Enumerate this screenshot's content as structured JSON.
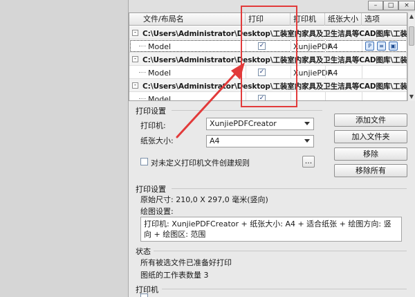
{
  "grid": {
    "columns": [
      "文件/布局名",
      "打印",
      "打印机",
      "纸张大小",
      "选项"
    ],
    "groups": [
      {
        "path": "C:\\Users\\Administrator\\Desktop\\工装室内家具及卫生洁具等CAD图库\\工装室内",
        "item": {
          "layout": "Model",
          "printer": "XunjiePDF",
          "size": "A4"
        }
      },
      {
        "path": "C:\\Users\\Administrator\\Desktop\\工装室内家具及卫生洁具等CAD图库\\工装室内",
        "item": {
          "layout": "Model",
          "printer": "XunjiePDF",
          "size": "A4"
        }
      },
      {
        "path": "C:\\Users\\Administrator\\Desktop\\工装室内家具及卫生洁具等CAD图库\\工装室内",
        "item": {
          "layout": "Model",
          "printer": "",
          "size": ""
        }
      }
    ],
    "expander": "-",
    "check_mark": "✓"
  },
  "print_settings": {
    "title": "打印设置",
    "printer_label": "打印机:",
    "printer_value": "XunjiePDFCreator",
    "paper_label": "纸张大小:",
    "paper_value": "A4",
    "rule_label": "对未定义打印机文件创建规则",
    "ellipsis": "..."
  },
  "buttons": {
    "add_file": "添加文件",
    "add_folder": "加入文件夹",
    "remove": "移除",
    "remove_all": "移除所有"
  },
  "page_settings": {
    "title": "打印设置",
    "original_size": "原始尺寸: 210,0 X 297,0 毫米(竖向)",
    "plot_settings_label": "绘图设置:",
    "plot_settings_text": "打印机: XunjiePDFCreator + 纸张大小: A4 + 适合纸张 + 绘图方向: 竖向 + 绘图区: 范围"
  },
  "status": {
    "title": "状态",
    "line1": "所有被选文件已准备好打印",
    "line2": "图纸的工作表数量 3"
  },
  "printer_section": {
    "title": "打印机"
  },
  "window": {
    "min": "–",
    "max": "□",
    "close": "×"
  },
  "colors": {
    "highlight_box": "#e23a3a"
  },
  "icons": [
    "pdf-print-icon",
    "layers-icon",
    "page-setup-icon"
  ]
}
